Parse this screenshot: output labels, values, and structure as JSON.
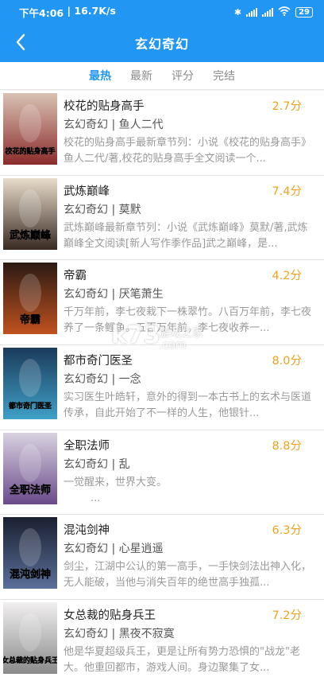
{
  "status_bar": {
    "time": "下午4:06",
    "speed": "16.7K/s",
    "battery": "29"
  },
  "header": {
    "title": "玄幻奇幻"
  },
  "tabs": [
    {
      "label": "最热",
      "active": true
    },
    {
      "label": "最新",
      "active": false
    },
    {
      "label": "评分",
      "active": false
    },
    {
      "label": "完结",
      "active": false
    }
  ],
  "books": [
    {
      "title": "校花的贴身高手",
      "score": "2.7分",
      "category": "玄幻奇幻",
      "author": "鱼人二代",
      "desc": "校花的贴身高手最新章节列：小说《校花的贴身高手》鱼人二代/著,校花的贴身高手全文阅读一个...",
      "cover_text": "校花的贴身高手",
      "cover_colors": [
        "#d9c2b4",
        "#8b2c2c"
      ]
    },
    {
      "title": "武炼巅峰",
      "score": "7.4分",
      "category": "玄幻奇幻",
      "author": "莫默",
      "desc": "武炼巅峰最新章节列：小说《武炼巅峰》莫默/著,武炼巅峰全文阅读[新人写作季作品]武之巅峰，是...",
      "cover_text": "武炼巅峰",
      "cover_colors": [
        "#e8dccb",
        "#3a2a22"
      ]
    },
    {
      "title": "帝霸",
      "score": "4.2分",
      "category": "玄幻奇幻",
      "author": "厌笔萧生",
      "desc": "千万年前，李七夜栽下一株翠竹。八百万年前，李七夜养了一条鲤鱼。五百万年前，李七夜收养一...",
      "cover_text": "帝霸",
      "cover_colors": [
        "#2b1a14",
        "#c0521f"
      ]
    },
    {
      "title": "都市奇门医圣",
      "score": "8.0分",
      "category": "玄幻奇幻",
      "author": "一念",
      "desc": "实习医生叶皓轩，意外的得到一本古书上的玄术与医道传承，自此开始了不一样的人生，他银针...",
      "cover_text": "都市奇门医圣",
      "cover_colors": [
        "#1b3b5a",
        "#3fa0c8"
      ]
    },
    {
      "title": "全职法师",
      "score": "8.8分",
      "category": "玄幻奇幻",
      "author": "乱",
      "desc": "一觉醒来，世界大变。",
      "desc2": "...",
      "cover_text": "全职法师",
      "cover_colors": [
        "#d8d2e0",
        "#6a4a8a"
      ]
    },
    {
      "title": "混沌剑神",
      "score": "6.3分",
      "category": "玄幻奇幻",
      "author": "心星逍遥",
      "desc": "剑尘，江湖中公认的第一高手，一手快剑法出神入化，无人能破，当他与消失百年的绝世高手独孤...",
      "cover_text": "混沌剑神",
      "cover_colors": [
        "#1a2030",
        "#5a6f9a"
      ]
    },
    {
      "title": "女总裁的贴身兵王",
      "score": "7.2分",
      "category": "玄幻奇幻",
      "author": "黑夜不寂寞",
      "desc": "他是华夏超级兵王，更是让所有势力恐惧的\"战龙\"老大。他重回都市，游戏人间。身边聚集了女...",
      "cover_text": "女总裁的贴身兵王",
      "cover_colors": [
        "#f1efef",
        "#8a8a8a"
      ]
    }
  ],
  "watermark": {
    "big": "k73",
    "cn": "游戏之家",
    "url": ".com"
  }
}
